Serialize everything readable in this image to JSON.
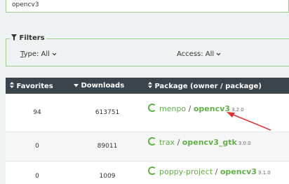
{
  "search": {
    "value": "opencv3"
  },
  "filters": {
    "title": "Filters",
    "type_label": "T",
    "type_label_rest": "ype: All",
    "access_label": "Access: All",
    "chevron": "chevron-down-icon"
  },
  "table": {
    "headers": {
      "favorites": "Favorites",
      "downloads": "Downloads",
      "package": "Package (owner / package)"
    },
    "rows": [
      {
        "favorites": "94",
        "downloads": "613751",
        "owner": "menpo",
        "separator": " / ",
        "package": "opencv3",
        "version": "3.2.0"
      },
      {
        "favorites": "0",
        "downloads": "89011",
        "owner": "trax",
        "separator": " / ",
        "package": "opencv3_gtk",
        "version": "3.0.0"
      },
      {
        "favorites": "0",
        "downloads": "1009",
        "owner": "poppy-project",
        "separator": " / ",
        "package": "opencv3",
        "version": "3.1.0"
      }
    ]
  },
  "annotation": {
    "color": "#e03030"
  }
}
